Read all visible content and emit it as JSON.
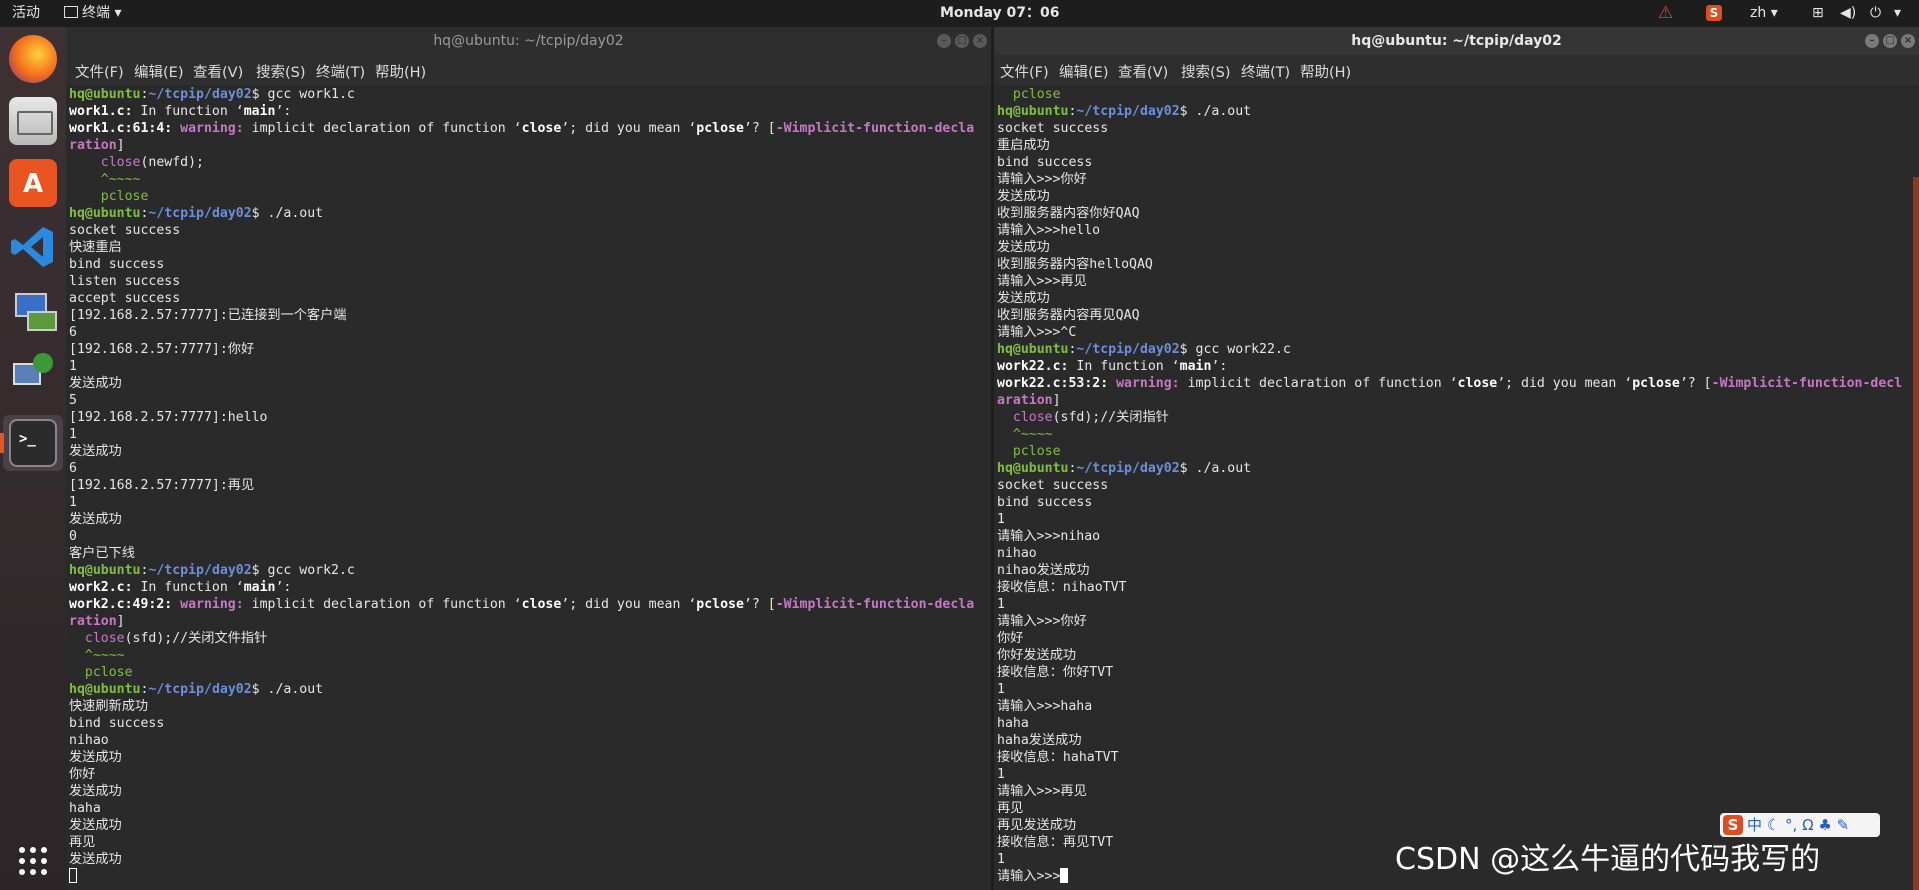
{
  "topbar": {
    "activities": "活动",
    "app_menu": "终端",
    "clock": "Monday 07：06",
    "lang": "zh"
  },
  "left_window": {
    "title": "hq@ubuntu: ~/tcpip/day02",
    "menu": [
      "文件(F)",
      "编辑(E)",
      "查看(V)",
      "搜索(S)",
      "终端(T)",
      "帮助(H)"
    ],
    "lines": [
      [
        {
          "t": "hq@ubuntu",
          "c": "p-user"
        },
        {
          "t": ":",
          "c": ""
        },
        {
          "t": "~/tcpip/day02",
          "c": "p-path"
        },
        {
          "t": "$ gcc work1.c",
          "c": ""
        }
      ],
      [
        {
          "t": "work1.c:",
          "c": "bold"
        },
        {
          "t": " In function ‘",
          "c": ""
        },
        {
          "t": "main",
          "c": "bold"
        },
        {
          "t": "’:",
          "c": ""
        }
      ],
      [
        {
          "t": "work1.c:61:4:",
          "c": "bold"
        },
        {
          "t": " ",
          "c": ""
        },
        {
          "t": "warning:",
          "c": "warn"
        },
        {
          "t": " implicit declaration of function ‘",
          "c": ""
        },
        {
          "t": "close",
          "c": "bold"
        },
        {
          "t": "’; did you mean ‘",
          "c": ""
        },
        {
          "t": "pclose",
          "c": "bold"
        },
        {
          "t": "’? [",
          "c": ""
        },
        {
          "t": "-Wimplicit-function-decla",
          "c": "flag"
        }
      ],
      [
        {
          "t": "ration",
          "c": "flag"
        },
        {
          "t": "]",
          "c": ""
        }
      ],
      [
        {
          "t": "    ",
          "c": ""
        },
        {
          "t": "close",
          "c": "code"
        },
        {
          "t": "(newfd);",
          "c": ""
        }
      ],
      [
        {
          "t": "    ^~~~~",
          "c": "caret"
        }
      ],
      [
        {
          "t": "    pclose",
          "c": "fix"
        }
      ],
      [
        {
          "t": "hq@ubuntu",
          "c": "p-user"
        },
        {
          "t": ":",
          "c": ""
        },
        {
          "t": "~/tcpip/day02",
          "c": "p-path"
        },
        {
          "t": "$ ./a.out",
          "c": ""
        }
      ],
      [
        {
          "t": "socket success",
          "c": ""
        }
      ],
      [
        {
          "t": "快速重启",
          "c": ""
        }
      ],
      [
        {
          "t": "bind success",
          "c": ""
        }
      ],
      [
        {
          "t": "listen success",
          "c": ""
        }
      ],
      [
        {
          "t": "accept success",
          "c": ""
        }
      ],
      [
        {
          "t": "[192.168.2.57:7777]:已连接到一个客户端",
          "c": ""
        }
      ],
      [
        {
          "t": "6",
          "c": ""
        }
      ],
      [
        {
          "t": "[192.168.2.57:7777]:你好",
          "c": ""
        }
      ],
      [
        {
          "t": "1",
          "c": ""
        }
      ],
      [
        {
          "t": "发送成功",
          "c": ""
        }
      ],
      [
        {
          "t": "5",
          "c": ""
        }
      ],
      [
        {
          "t": "[192.168.2.57:7777]:hello",
          "c": ""
        }
      ],
      [
        {
          "t": "1",
          "c": ""
        }
      ],
      [
        {
          "t": "发送成功",
          "c": ""
        }
      ],
      [
        {
          "t": "6",
          "c": ""
        }
      ],
      [
        {
          "t": "[192.168.2.57:7777]:再见",
          "c": ""
        }
      ],
      [
        {
          "t": "1",
          "c": ""
        }
      ],
      [
        {
          "t": "发送成功",
          "c": ""
        }
      ],
      [
        {
          "t": "0",
          "c": ""
        }
      ],
      [
        {
          "t": "客户已下线",
          "c": ""
        }
      ],
      [
        {
          "t": "hq@ubuntu",
          "c": "p-user"
        },
        {
          "t": ":",
          "c": ""
        },
        {
          "t": "~/tcpip/day02",
          "c": "p-path"
        },
        {
          "t": "$ gcc work2.c",
          "c": ""
        }
      ],
      [
        {
          "t": "work2.c:",
          "c": "bold"
        },
        {
          "t": " In function ‘",
          "c": ""
        },
        {
          "t": "main",
          "c": "bold"
        },
        {
          "t": "’:",
          "c": ""
        }
      ],
      [
        {
          "t": "work2.c:49:2:",
          "c": "bold"
        },
        {
          "t": " ",
          "c": ""
        },
        {
          "t": "warning:",
          "c": "warn"
        },
        {
          "t": " implicit declaration of function ‘",
          "c": ""
        },
        {
          "t": "close",
          "c": "bold"
        },
        {
          "t": "’; did you mean ‘",
          "c": ""
        },
        {
          "t": "pclose",
          "c": "bold"
        },
        {
          "t": "’? [",
          "c": ""
        },
        {
          "t": "-Wimplicit-function-decla",
          "c": "flag"
        }
      ],
      [
        {
          "t": "ration",
          "c": "flag"
        },
        {
          "t": "]",
          "c": ""
        }
      ],
      [
        {
          "t": "  ",
          "c": ""
        },
        {
          "t": "close",
          "c": "code"
        },
        {
          "t": "(sfd);//关闭文件指针",
          "c": ""
        }
      ],
      [
        {
          "t": "  ^~~~~",
          "c": "caret"
        }
      ],
      [
        {
          "t": "  pclose",
          "c": "fix"
        }
      ],
      [
        {
          "t": "hq@ubuntu",
          "c": "p-user"
        },
        {
          "t": ":",
          "c": ""
        },
        {
          "t": "~/tcpip/day02",
          "c": "p-path"
        },
        {
          "t": "$ ./a.out",
          "c": ""
        }
      ],
      [
        {
          "t": "快速刷新成功",
          "c": ""
        }
      ],
      [
        {
          "t": "bind success",
          "c": ""
        }
      ],
      [
        {
          "t": "nihao",
          "c": ""
        }
      ],
      [
        {
          "t": "发送成功",
          "c": ""
        }
      ],
      [
        {
          "t": "你好",
          "c": ""
        }
      ],
      [
        {
          "t": "发送成功",
          "c": ""
        }
      ],
      [
        {
          "t": "haha",
          "c": ""
        }
      ],
      [
        {
          "t": "发送成功",
          "c": ""
        }
      ],
      [
        {
          "t": "再见",
          "c": ""
        }
      ],
      [
        {
          "t": "发送成功",
          "c": ""
        }
      ],
      [
        {
          "t": "",
          "c": "cursor-hollow"
        }
      ]
    ]
  },
  "right_window": {
    "title": "hq@ubuntu: ~/tcpip/day02",
    "menu": [
      "文件(F)",
      "编辑(E)",
      "查看(V)",
      "搜索(S)",
      "终端(T)",
      "帮助(H)"
    ],
    "lines": [
      [
        {
          "t": "  pclose",
          "c": "fix"
        }
      ],
      [
        {
          "t": "hq@ubuntu",
          "c": "p-user"
        },
        {
          "t": ":",
          "c": ""
        },
        {
          "t": "~/tcpip/day02",
          "c": "p-path"
        },
        {
          "t": "$ ./a.out",
          "c": ""
        }
      ],
      [
        {
          "t": "socket success",
          "c": ""
        }
      ],
      [
        {
          "t": "重启成功",
          "c": ""
        }
      ],
      [
        {
          "t": "bind success",
          "c": ""
        }
      ],
      [
        {
          "t": "请输入>>>你好",
          "c": ""
        }
      ],
      [
        {
          "t": "发送成功",
          "c": ""
        }
      ],
      [
        {
          "t": "收到服务器内容你好QAQ",
          "c": ""
        }
      ],
      [
        {
          "t": "请输入>>>hello",
          "c": ""
        }
      ],
      [
        {
          "t": "发送成功",
          "c": ""
        }
      ],
      [
        {
          "t": "收到服务器内容helloQAQ",
          "c": ""
        }
      ],
      [
        {
          "t": "请输入>>>再见",
          "c": ""
        }
      ],
      [
        {
          "t": "发送成功",
          "c": ""
        }
      ],
      [
        {
          "t": "收到服务器内容再见QAQ",
          "c": ""
        }
      ],
      [
        {
          "t": "请输入>>>^C",
          "c": ""
        }
      ],
      [
        {
          "t": "hq@ubuntu",
          "c": "p-user"
        },
        {
          "t": ":",
          "c": ""
        },
        {
          "t": "~/tcpip/day02",
          "c": "p-path"
        },
        {
          "t": "$ gcc work22.c",
          "c": ""
        }
      ],
      [
        {
          "t": "work22.c:",
          "c": "bold"
        },
        {
          "t": " In function ‘",
          "c": ""
        },
        {
          "t": "main",
          "c": "bold"
        },
        {
          "t": "’:",
          "c": ""
        }
      ],
      [
        {
          "t": "work22.c:53:2:",
          "c": "bold"
        },
        {
          "t": " ",
          "c": ""
        },
        {
          "t": "warning:",
          "c": "warn"
        },
        {
          "t": " implicit declaration of function ‘",
          "c": ""
        },
        {
          "t": "close",
          "c": "bold"
        },
        {
          "t": "’; did you mean ‘",
          "c": ""
        },
        {
          "t": "pclose",
          "c": "bold"
        },
        {
          "t": "’? [",
          "c": ""
        },
        {
          "t": "-Wimplicit-function-decl",
          "c": "flag"
        }
      ],
      [
        {
          "t": "aration",
          "c": "flag"
        },
        {
          "t": "]",
          "c": ""
        }
      ],
      [
        {
          "t": "  ",
          "c": ""
        },
        {
          "t": "close",
          "c": "code"
        },
        {
          "t": "(sfd);//关闭指针",
          "c": ""
        }
      ],
      [
        {
          "t": "  ^~~~~",
          "c": "caret"
        }
      ],
      [
        {
          "t": "  pclose",
          "c": "fix"
        }
      ],
      [
        {
          "t": "hq@ubuntu",
          "c": "p-user"
        },
        {
          "t": ":",
          "c": ""
        },
        {
          "t": "~/tcpip/day02",
          "c": "p-path"
        },
        {
          "t": "$ ./a.out",
          "c": ""
        }
      ],
      [
        {
          "t": "socket success",
          "c": ""
        }
      ],
      [
        {
          "t": "bind success",
          "c": ""
        }
      ],
      [
        {
          "t": "1",
          "c": ""
        }
      ],
      [
        {
          "t": "请输入>>>nihao",
          "c": ""
        }
      ],
      [
        {
          "t": "nihao",
          "c": ""
        }
      ],
      [
        {
          "t": "nihao发送成功",
          "c": ""
        }
      ],
      [
        {
          "t": "接收信息：nihaoTVT",
          "c": ""
        }
      ],
      [
        {
          "t": "1",
          "c": ""
        }
      ],
      [
        {
          "t": "请输入>>>你好",
          "c": ""
        }
      ],
      [
        {
          "t": "你好",
          "c": ""
        }
      ],
      [
        {
          "t": "你好发送成功",
          "c": ""
        }
      ],
      [
        {
          "t": "接收信息：你好TVT",
          "c": ""
        }
      ],
      [
        {
          "t": "1",
          "c": ""
        }
      ],
      [
        {
          "t": "请输入>>>haha",
          "c": ""
        }
      ],
      [
        {
          "t": "haha",
          "c": ""
        }
      ],
      [
        {
          "t": "haha发送成功",
          "c": ""
        }
      ],
      [
        {
          "t": "接收信息：hahaTVT",
          "c": ""
        }
      ],
      [
        {
          "t": "1",
          "c": ""
        }
      ],
      [
        {
          "t": "请输入>>>再见",
          "c": ""
        }
      ],
      [
        {
          "t": "再见",
          "c": ""
        }
      ],
      [
        {
          "t": "再见发送成功",
          "c": ""
        }
      ],
      [
        {
          "t": "接收信息：再见TVT",
          "c": ""
        }
      ],
      [
        {
          "t": "1",
          "c": ""
        }
      ],
      [
        {
          "t": "请输入>>>",
          "c": ""
        },
        {
          "t": "",
          "c": "cursor"
        }
      ]
    ]
  },
  "dock": [
    {
      "icon": "firefox-icon"
    },
    {
      "icon": "files-icon"
    },
    {
      "icon": "software-center-icon"
    },
    {
      "icon": "vscode-icon"
    },
    {
      "icon": "network-tool-icon"
    },
    {
      "icon": "network-computers-icon"
    },
    {
      "icon": "terminal-icon"
    },
    {
      "icon": "show-apps-icon"
    }
  ],
  "ime": "中",
  "watermark": "CSDN @这么牛逼的代码我写的",
  "colors": {
    "prompt_user": "#7fbf3f",
    "prompt_path": "#6b8fd8",
    "warning": "#c678c6"
  }
}
